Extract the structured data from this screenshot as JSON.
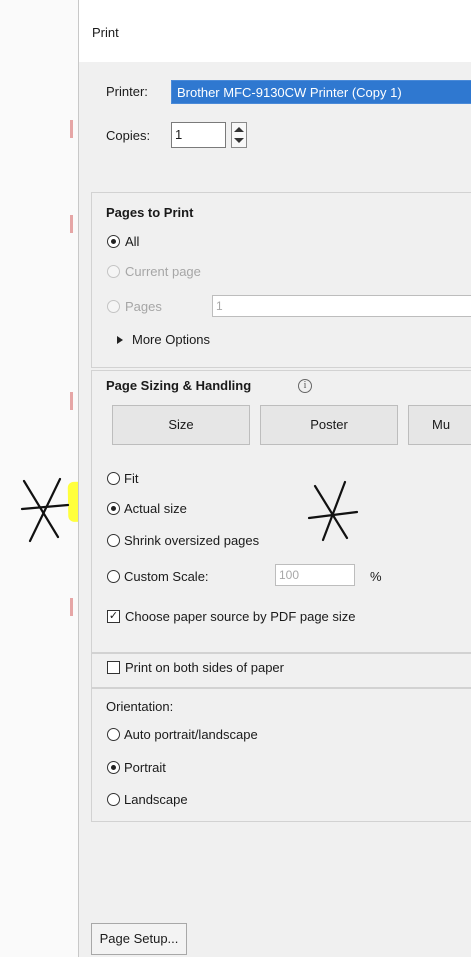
{
  "dialog": {
    "title": "Print"
  },
  "printer": {
    "label": "Printer:",
    "selected": "Brother MFC-9130CW Printer (Copy 1)"
  },
  "copies": {
    "label": "Copies:",
    "value": "1"
  },
  "pages_to_print": {
    "heading": "Pages to Print",
    "options": [
      {
        "label": "All",
        "selected": true,
        "enabled": true
      },
      {
        "label": "Current page",
        "selected": false,
        "enabled": false
      },
      {
        "label": "Pages",
        "selected": false,
        "enabled": false
      }
    ],
    "pages_value": "1",
    "more_options": "More Options"
  },
  "page_sizing": {
    "heading": "Page Sizing & Handling",
    "info_icon": "i",
    "tabs": [
      "Size",
      "Poster",
      "Mu"
    ],
    "options": [
      {
        "label": "Fit",
        "selected": false
      },
      {
        "label": "Actual size",
        "selected": true
      },
      {
        "label": "Shrink oversized pages",
        "selected": false
      },
      {
        "label": "Custom Scale:",
        "selected": false
      }
    ],
    "custom_scale_value": "100",
    "custom_scale_unit": "%",
    "choose_paper_source": {
      "label": "Choose paper source by PDF page size",
      "checked": true,
      "check_glyph": "✓"
    }
  },
  "duplex": {
    "label": "Print on both sides of paper",
    "checked": false
  },
  "orientation": {
    "heading": "Orientation:",
    "options": [
      {
        "label": "Auto portrait/landscape",
        "selected": false
      },
      {
        "label": "Portrait",
        "selected": true
      },
      {
        "label": "Landscape",
        "selected": false
      }
    ]
  },
  "footer": {
    "page_setup_label": "Page Setup..."
  },
  "colors": {
    "selection_blue": "#2f78d0",
    "highlighter": "#ffff3d"
  }
}
